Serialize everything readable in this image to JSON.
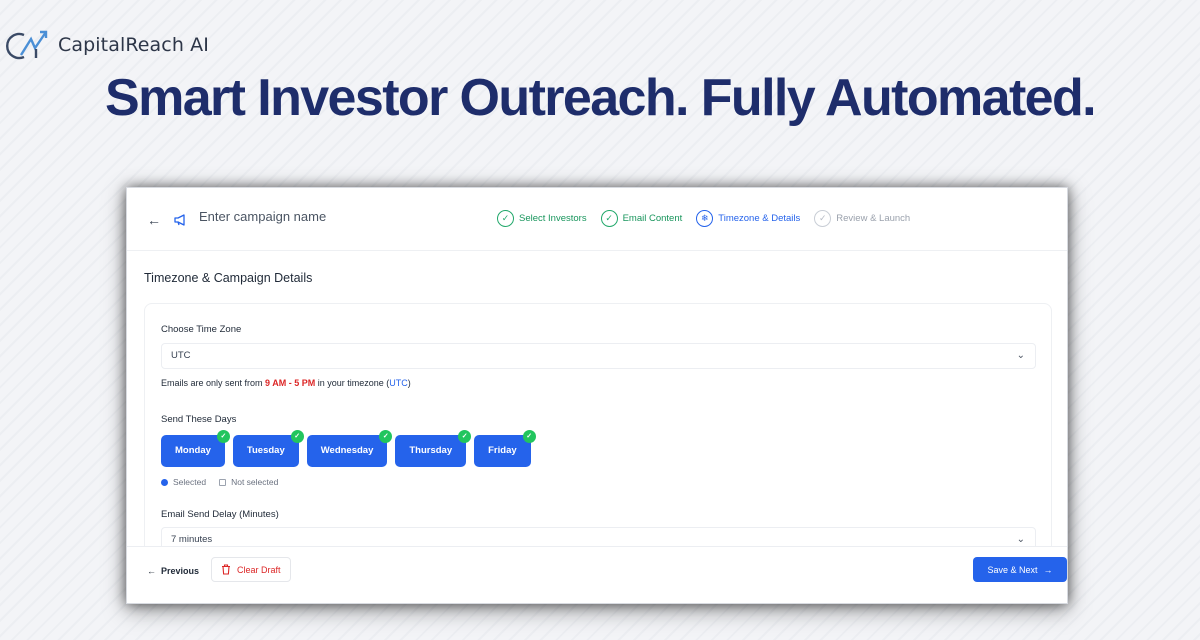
{
  "brand": {
    "name": "CapitalReach AI",
    "logo_icon": "cr-logo-icon"
  },
  "hero": {
    "title": "Smart Investor Outreach. Fully Automated."
  },
  "topbar": {
    "back_icon": "arrow-left-icon",
    "campaign_icon": "megaphone-icon",
    "campaign_placeholder": "Enter campaign name",
    "steps": [
      {
        "label": "Select Investors",
        "status": "done",
        "icon": "check-circle-icon"
      },
      {
        "label": "Email Content",
        "status": "done",
        "icon": "check-circle-icon"
      },
      {
        "label": "Timezone & Details",
        "status": "active",
        "icon": "globe-icon"
      },
      {
        "label": "Review & Launch",
        "status": "pending",
        "icon": "check-circle-icon"
      }
    ]
  },
  "page": {
    "section_title": "Timezone & Campaign Details"
  },
  "timezone": {
    "label": "Choose Time Zone",
    "value": "UTC",
    "hint_prefix": "Emails are only sent from ",
    "hint_hours": "9 AM - 5 PM",
    "hint_middle": " in your timezone (",
    "hint_tz": "UTC",
    "hint_suffix": ")"
  },
  "days": {
    "label": "Send These Days",
    "items": [
      "Monday",
      "Tuesday",
      "Wednesday",
      "Thursday",
      "Friday"
    ],
    "legend_selected": "Selected",
    "legend_not_selected": "Not selected"
  },
  "delay": {
    "label": "Email Send Delay (Minutes)",
    "value": "7 minutes"
  },
  "footer": {
    "previous_label": "Previous",
    "clear_label": "Clear Draft",
    "save_label": "Save & Next"
  },
  "colors": {
    "accent": "#2563eb",
    "success": "#22a86b",
    "danger": "#dc2626",
    "hero": "#1e2d6b"
  }
}
